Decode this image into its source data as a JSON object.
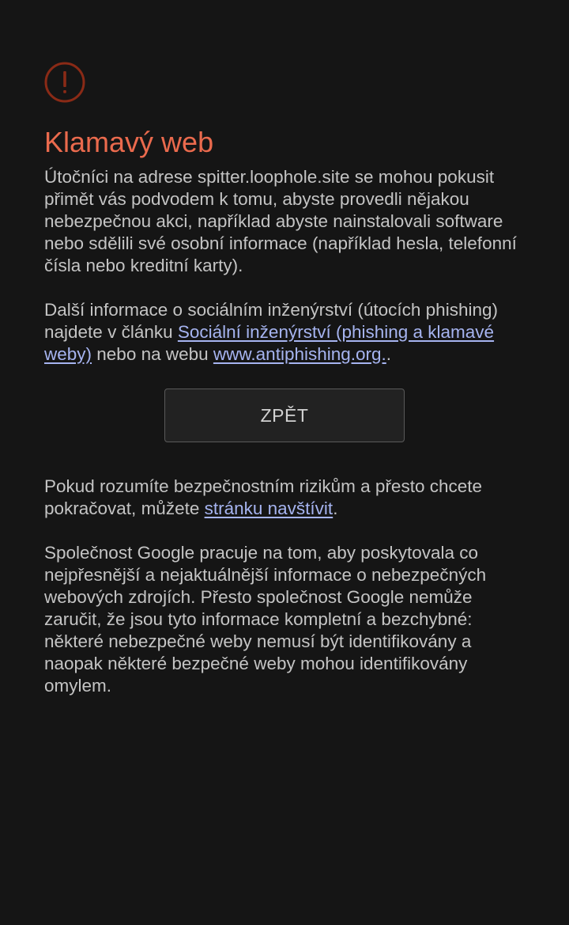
{
  "warning": {
    "icon": "exclamation-circle-icon",
    "title": "Klamavý web",
    "accent_color": "#ea6a4d"
  },
  "paragraph1": "Útočníci na adrese spitter.loophole.site se mohou pokusit přimět vás podvodem k tomu, abyste provedli nějakou nebezpečnou akci, například abyste nainstalovali software nebo sdělili své osobní informace (například hesla, telefonní čísla nebo kreditní karty).",
  "paragraph2": {
    "text_before": "Další informace o sociálním inženýrství (útocích phishing) najdete v článku ",
    "link1": "Sociální inženýrství (phishing a klamavé weby)",
    "text_middle": " nebo na webu ",
    "link2": "www.antiphishing.org.",
    "text_after": "."
  },
  "back_button": "ZPĚT",
  "paragraph3": {
    "text_before": "Pokud rozumíte bezpečnostním rizikům a přesto chcete pokračovat, můžete ",
    "link": "stránku navštívit",
    "text_after": "."
  },
  "paragraph4": "Společnost Google pracuje na tom, aby poskytovala co nejpřesnější a nejaktuálnější informace o nebezpečných webových zdrojích. Přesto společnost Google nemůže zaručit, že jsou tyto informace kompletní a bezchybné: některé nebezpečné weby nemusí být identifikovány a naopak některé bezpečné weby mohou identifikovány omylem.",
  "colors": {
    "background": "#151515",
    "text": "#c4c4c4",
    "link": "#a6b4f0",
    "button_bg": "#222222"
  }
}
